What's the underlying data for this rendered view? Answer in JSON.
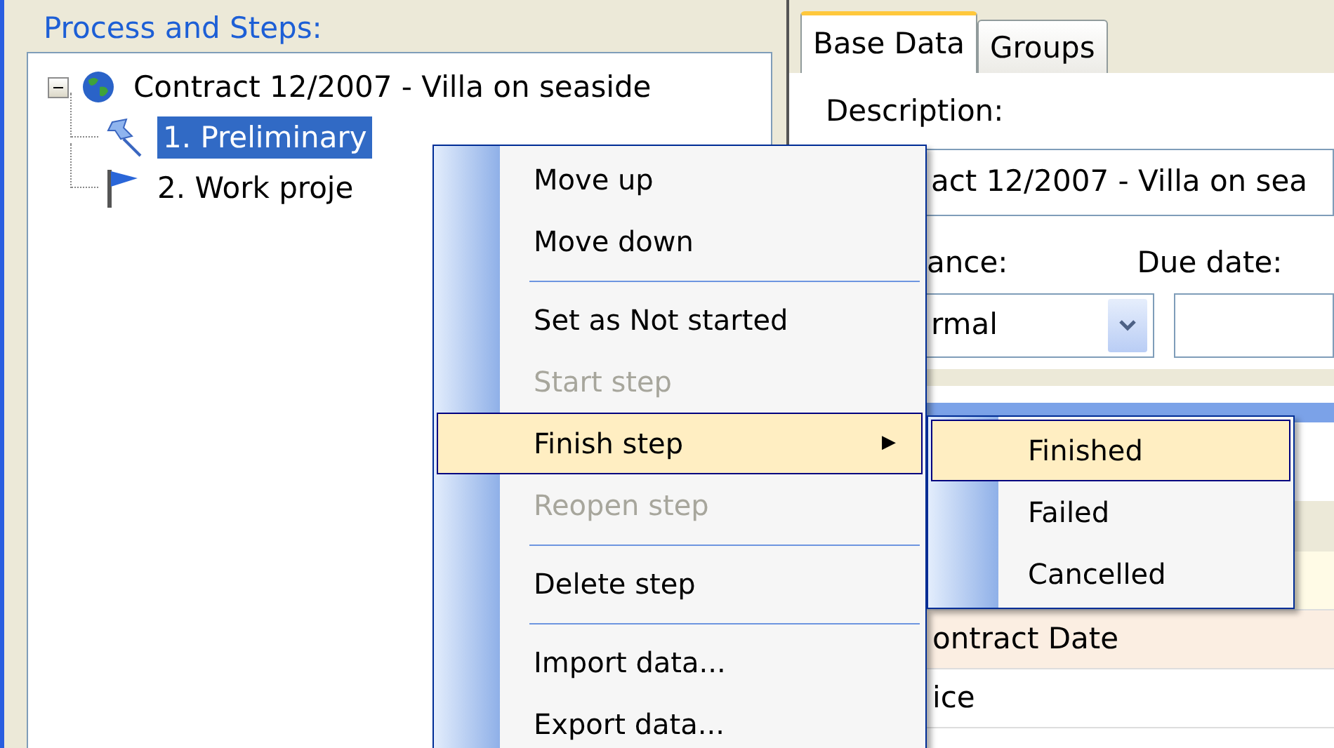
{
  "panel": {
    "title": "Process and Steps:"
  },
  "tree": [
    {
      "label": "Contract 12/2007 - Villa on seaside",
      "kind": "globe",
      "expanded": true,
      "selected": false,
      "children": [
        {
          "label": "1. Preliminary",
          "kind": "pin",
          "selected": true
        },
        {
          "label": "2. Work proje",
          "kind": "flag",
          "selected": false
        }
      ]
    }
  ],
  "tabs": [
    {
      "label": "Base Data",
      "selected": true
    },
    {
      "label": "Groups",
      "selected": false
    }
  ],
  "form": {
    "description_label": "Description:",
    "description_value": "act 12/2007 - Villa on sea",
    "importance_label": "ance:",
    "importance_value": "rmal",
    "due_date_label": "Due date:"
  },
  "rows": [
    {
      "cell": "ontract Date",
      "kind": "shaded"
    },
    {
      "cell": "ice",
      "kind": "plain"
    }
  ],
  "context_menu": {
    "items": [
      {
        "kind": "item",
        "label": "Move up",
        "disabled": false,
        "selected": false
      },
      {
        "kind": "item",
        "label": "Move down",
        "disabled": false,
        "selected": false
      },
      {
        "kind": "separator"
      },
      {
        "kind": "item",
        "label": "Set as Not started",
        "disabled": false,
        "selected": false
      },
      {
        "kind": "item",
        "label": "Start step",
        "disabled": true,
        "selected": false
      },
      {
        "kind": "submenu",
        "label": "Finish step",
        "disabled": false,
        "selected": true,
        "submenu_arrow": "▶"
      },
      {
        "kind": "item",
        "label": "Reopen step",
        "disabled": true,
        "selected": false
      },
      {
        "kind": "separator"
      },
      {
        "kind": "item",
        "label": "Delete step",
        "disabled": false,
        "selected": false
      },
      {
        "kind": "separator"
      },
      {
        "kind": "item",
        "label": "Import data...",
        "disabled": false,
        "selected": false
      },
      {
        "kind": "item",
        "label": "Export data...",
        "disabled": false,
        "selected": false
      }
    ]
  },
  "submenu": {
    "items": [
      {
        "label": "Finished",
        "selected": true
      },
      {
        "label": "Failed",
        "selected": false
      },
      {
        "label": "Cancelled",
        "selected": false
      }
    ]
  }
}
